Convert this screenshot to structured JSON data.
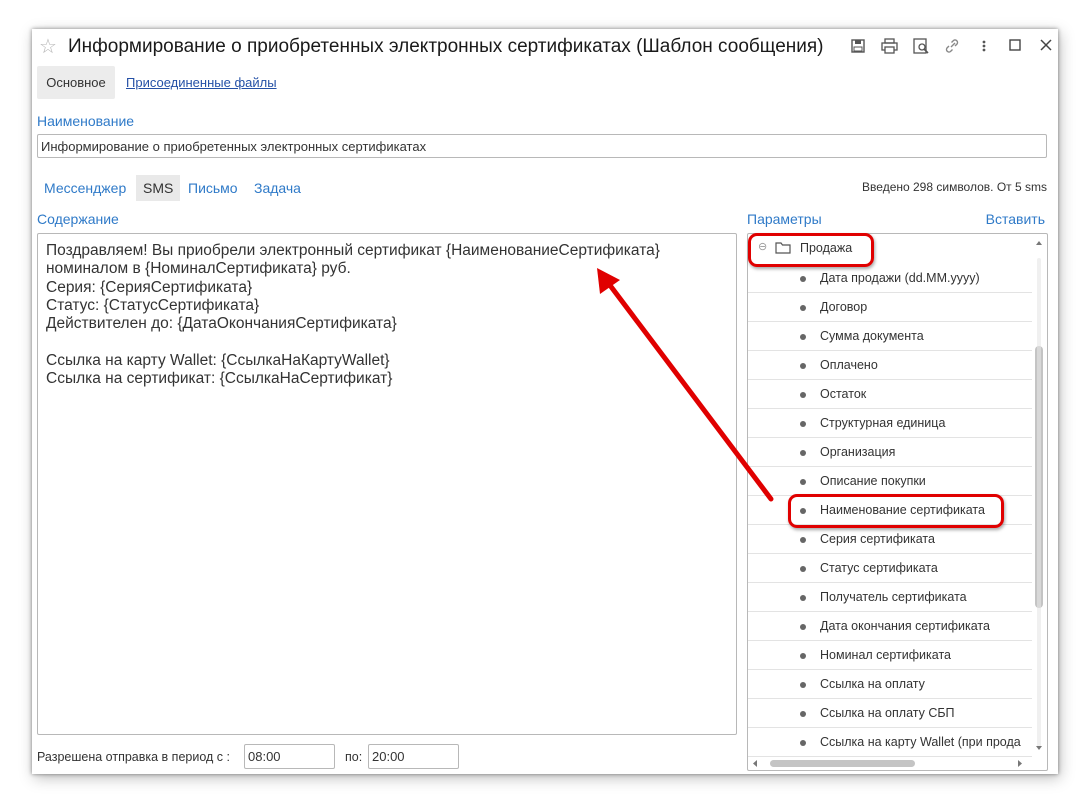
{
  "window": {
    "title": "Информирование о приобретенных электронных сертификатах (Шаблон сообщения)",
    "toolbar_icons": [
      "save-icon",
      "print-icon",
      "preview-icon",
      "link-icon",
      "more-icon",
      "maximize-icon",
      "close-icon"
    ]
  },
  "tabs": {
    "main": "Основное",
    "files": "Присоединенные файлы"
  },
  "name_field": {
    "label": "Наименование",
    "value": "Информирование о приобретенных электронных сертификатах"
  },
  "channels": {
    "items": [
      "Мессенджер",
      "SMS",
      "Письмо",
      "Задача"
    ],
    "active": "SMS",
    "counter": "Введено 298 символов. От 5 sms"
  },
  "content": {
    "label": "Содержание",
    "text": "Поздравляем! Вы приобрели электронный сертификат {НаименованиеСертификата}\nноминалом в {НоминалСертификата} руб.\nСерия: {СерияСертификата}\nСтатус: {СтатусСертификата}\nДействителен до: {ДатаОкончанияСертификата}\n\nСсылка на карту Wallet: {СсылкаНаКартуWallet}\nСсылка на сертификат: {СсылкаНаСертификат}"
  },
  "params": {
    "label": "Параметры",
    "insert": "Вставить",
    "group": "Продажа",
    "items": [
      "Дата продажи (dd.MM.yyyy)",
      "Договор",
      "Сумма документа",
      "Оплачено",
      "Остаток",
      "Структурная единица",
      "Организация",
      "Описание покупки",
      "Наименование сертификата",
      "Серия сертификата",
      "Статус сертификата",
      "Получатель сертификата",
      "Дата окончания сертификата",
      "Номинал сертификата",
      "Ссылка на оплату",
      "Ссылка на оплату СБП",
      "Ссылка на карту Wallet (при прода"
    ]
  },
  "period": {
    "label": "Разрешена отправка в период с :",
    "from": "08:00",
    "to_label": "по:",
    "to": "20:00"
  },
  "colors": {
    "link": "#2f7ac8",
    "highlight": "#e00000"
  }
}
